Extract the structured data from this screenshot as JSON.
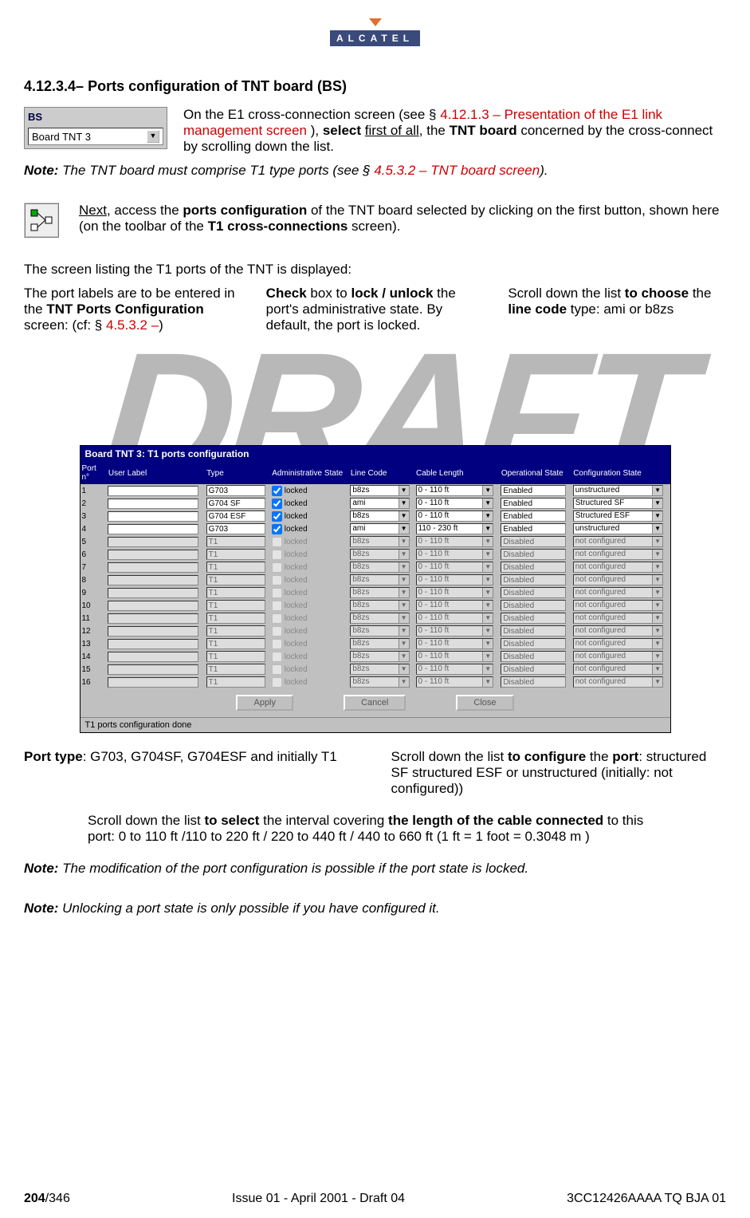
{
  "logo_letters": "ALCATEL",
  "section_title": "4.12.3.4– Ports configuration of TNT board (BS)",
  "bs_box": {
    "title": "BS",
    "field": "Board TNT 3"
  },
  "para1_pre": "On the E1 cross-connection screen (see § ",
  "para1_red": "4.12.1.3 – Presentation of the E1 link management screen ",
  "para1_mid": "), ",
  "para1_b1": "select ",
  "para1_u": "first of all",
  "para1_mid2": ", the ",
  "para1_b2": "TNT board",
  "para1_post": " concerned by the cross-connect by scrolling down the list.",
  "note1_pre": "Note:  ",
  "note1_body": "The TNT board must comprise T1 type ports (see § ",
  "note1_red": "4.5.3.2 – TNT board screen",
  "note1_post": ").",
  "para2_u": "Next",
  "para2_mid": ", access the ",
  "para2_b1": "ports configuration",
  "para2_mid2": " of the TNT board selected by clicking on the first button, shown here (on the toolbar of the ",
  "para2_b2": "T1 cross-connections",
  "para2_post": " screen).",
  "intro": "The screen listing the T1 ports of the TNT is displayed:",
  "annot": {
    "a1_pre": "The port labels are to be entered in the ",
    "a1_b": "TNT Ports Configuration",
    "a1_post": " screen: (cf: § ",
    "a1_red": "4.5.3.2 –",
    "a1_end": ")",
    "a2_b1": "Check",
    "a2_mid": " box to ",
    "a2_b2": "lock / unlock",
    "a2_post": " the port's administrative state. By default, the port is locked.",
    "a3_pre": "Scroll down the list ",
    "a3_b": "to choose",
    "a3_mid": " the ",
    "a3_b2": "line code",
    "a3_post": " type: ami or b8zs"
  },
  "win_title": "Board TNT 3: T1 ports configuration",
  "headers": [
    "Port n°",
    "User Label",
    "Type",
    "Administrative State",
    "Line Code",
    "Cable Length",
    "Operational State",
    "Configuration State"
  ],
  "rows": [
    {
      "n": "1",
      "label": "",
      "type": "G703",
      "locked": true,
      "line": "b8zs",
      "cable": "0 - 110 ft",
      "op": "Enabled",
      "conf": "unstructured",
      "en": true
    },
    {
      "n": "2",
      "label": "",
      "type": "G704 SF",
      "locked": true,
      "line": "ami",
      "cable": "0 - 110 ft",
      "op": "Enabled",
      "conf": "Structured SF",
      "en": true
    },
    {
      "n": "3",
      "label": "",
      "type": "G704 ESF",
      "locked": true,
      "line": "b8zs",
      "cable": "0 - 110 ft",
      "op": "Enabled",
      "conf": "Structured ESF",
      "en": true
    },
    {
      "n": "4",
      "label": "",
      "type": "G703",
      "locked": true,
      "line": "ami",
      "cable": "110 - 230 ft",
      "op": "Enabled",
      "conf": "unstructured",
      "en": true
    },
    {
      "n": "5",
      "label": "",
      "type": "T1",
      "locked": false,
      "line": "b8zs",
      "cable": "0 - 110 ft",
      "op": "Disabled",
      "conf": "not configured",
      "en": false
    },
    {
      "n": "6",
      "label": "",
      "type": "T1",
      "locked": false,
      "line": "b8zs",
      "cable": "0 - 110 ft",
      "op": "Disabled",
      "conf": "not configured",
      "en": false
    },
    {
      "n": "7",
      "label": "",
      "type": "T1",
      "locked": false,
      "line": "b8zs",
      "cable": "0 - 110 ft",
      "op": "Disabled",
      "conf": "not configured",
      "en": false
    },
    {
      "n": "8",
      "label": "",
      "type": "T1",
      "locked": false,
      "line": "b8zs",
      "cable": "0 - 110 ft",
      "op": "Disabled",
      "conf": "not configured",
      "en": false
    },
    {
      "n": "9",
      "label": "",
      "type": "T1",
      "locked": false,
      "line": "b8zs",
      "cable": "0 - 110 ft",
      "op": "Disabled",
      "conf": "not configured",
      "en": false
    },
    {
      "n": "10",
      "label": "",
      "type": "T1",
      "locked": false,
      "line": "b8zs",
      "cable": "0 - 110 ft",
      "op": "Disabled",
      "conf": "not configured",
      "en": false
    },
    {
      "n": "11",
      "label": "",
      "type": "T1",
      "locked": false,
      "line": "b8zs",
      "cable": "0 - 110 ft",
      "op": "Disabled",
      "conf": "not configured",
      "en": false
    },
    {
      "n": "12",
      "label": "",
      "type": "T1",
      "locked": false,
      "line": "b8zs",
      "cable": "0 - 110 ft",
      "op": "Disabled",
      "conf": "not configured",
      "en": false
    },
    {
      "n": "13",
      "label": "",
      "type": "T1",
      "locked": false,
      "line": "b8zs",
      "cable": "0 - 110 ft",
      "op": "Disabled",
      "conf": "not configured",
      "en": false
    },
    {
      "n": "14",
      "label": "",
      "type": "T1",
      "locked": false,
      "line": "b8zs",
      "cable": "0 - 110 ft",
      "op": "Disabled",
      "conf": "not configured",
      "en": false
    },
    {
      "n": "15",
      "label": "",
      "type": "T1",
      "locked": false,
      "line": "b8zs",
      "cable": "0 - 110 ft",
      "op": "Disabled",
      "conf": "not configured",
      "en": false
    },
    {
      "n": "16",
      "label": "",
      "type": "T1",
      "locked": false,
      "line": "b8zs",
      "cable": "0 - 110 ft",
      "op": "Disabled",
      "conf": "not configured",
      "en": false
    }
  ],
  "locked_label": "locked",
  "buttons": {
    "apply": "Apply",
    "cancel": "Cancel",
    "close": "Close"
  },
  "status": "T1 ports configuration done",
  "lower": {
    "l1_b": "Port type",
    "l1_post": ": G703, G704SF, G704ESF and initially T1",
    "l2_pre": "Scroll down the list ",
    "l2_b": "to configure",
    "l2_mid": " the ",
    "l2_b2": "port",
    "l2_post": ": structured SF structured ESF or unstructured (initially: not configured))",
    "l3_pre": "Scroll down the list ",
    "l3_b": "to select",
    "l3_mid": " the interval covering ",
    "l3_b2": "the length of the cable connected",
    "l3_post": " to this port: 0 to 110 ft /110 to 220 ft / 220 to 440 ft / 440 to 660 ft (1 ft = 1 foot = 0.3048 m )"
  },
  "note2_pre": "Note: ",
  "note2_body": "The modification of the port configuration is possible if the port state is locked.",
  "note3_pre": "Note: ",
  "note3_body": "Unlocking a port state is only possible if you have configured it.",
  "footer": {
    "page": "204",
    "total": "/346",
    "issue": "Issue 01 - April 2001 - Draft 04",
    "code": "3CC12426AAAA TQ BJA 01"
  },
  "draft_watermark": "DRAFT"
}
